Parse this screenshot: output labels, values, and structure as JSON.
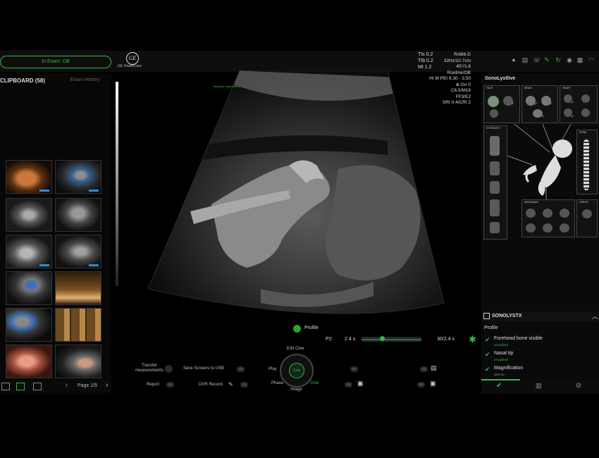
{
  "exam": {
    "label": "In Exam: OB"
  },
  "brand": {
    "logo": "GE",
    "name": "GE HealthCare"
  },
  "indices": [
    "TIs 0.2",
    "TIb 0.2",
    "MI  1.2"
  ],
  "top_icons": [
    "microphone-icon",
    "printer-icon",
    "phone-icon",
    "probe-icon",
    "sync-icon",
    "user-icon",
    "info-icon",
    "document-icon",
    "wifi-icon"
  ],
  "clipboard": {
    "title": "CLIPBOARD (58)",
    "exam_history": "Exam History",
    "page": "Page 1/5"
  },
  "image": {
    "protocol_label": "Validation Agreement",
    "params": [
      "RAB6-D",
      "32Hz/10.7cm",
      "45°/1.6",
      "Routine/OB",
      "HI M PEI 9.30 - 3.50",
      "⊕ Gn  0",
      "C6.5/M16",
      "FF3/E2",
      "SRI II 4/CRI 2"
    ]
  },
  "cine": {
    "profile_label": "Profile",
    "p2_label": "P2:",
    "p2_value": "2.4 s",
    "position_fraction": 0.35,
    "frame_value": "30/2.4 s",
    "edit_cine": "Edit Cine",
    "play": "Play",
    "cine_center": "Cine",
    "phase": "Phase",
    "image": "Image",
    "cine_right": "Cine"
  },
  "controls": {
    "transfer": "Transfer measurements",
    "save_usb": "Save Screens to USB",
    "report": "Report",
    "dvr": "DVR Record",
    "key_c1": "C1",
    "key_c2": "C2",
    "key_c3": "C3",
    "key_c4": "C4",
    "key_p1": "P1",
    "key_p2": "P2",
    "key_p3": "P3",
    "key_p4": "P4"
  },
  "sonolyst": {
    "title": "SonoLystlive",
    "groups": {
      "face": "FACE",
      "brain": "BRAIN",
      "heart": "HEART",
      "extremity": "EXTREMITY",
      "spine": "SPINE",
      "abdominal": "ABDOMINAL",
      "cervix": "CERVIX"
    }
  },
  "sonolystx": {
    "title": "SONOLYSTX",
    "view": "Profile",
    "items": [
      {
        "label": "Forehead bone visible",
        "status": "visualized"
      },
      {
        "label": "Nasal tip",
        "status": "visualized"
      },
      {
        "label": "Magnification",
        "status": "optimal"
      }
    ]
  },
  "colors": {
    "accent": "#3bb54a",
    "marker": "#2a8fd4"
  }
}
